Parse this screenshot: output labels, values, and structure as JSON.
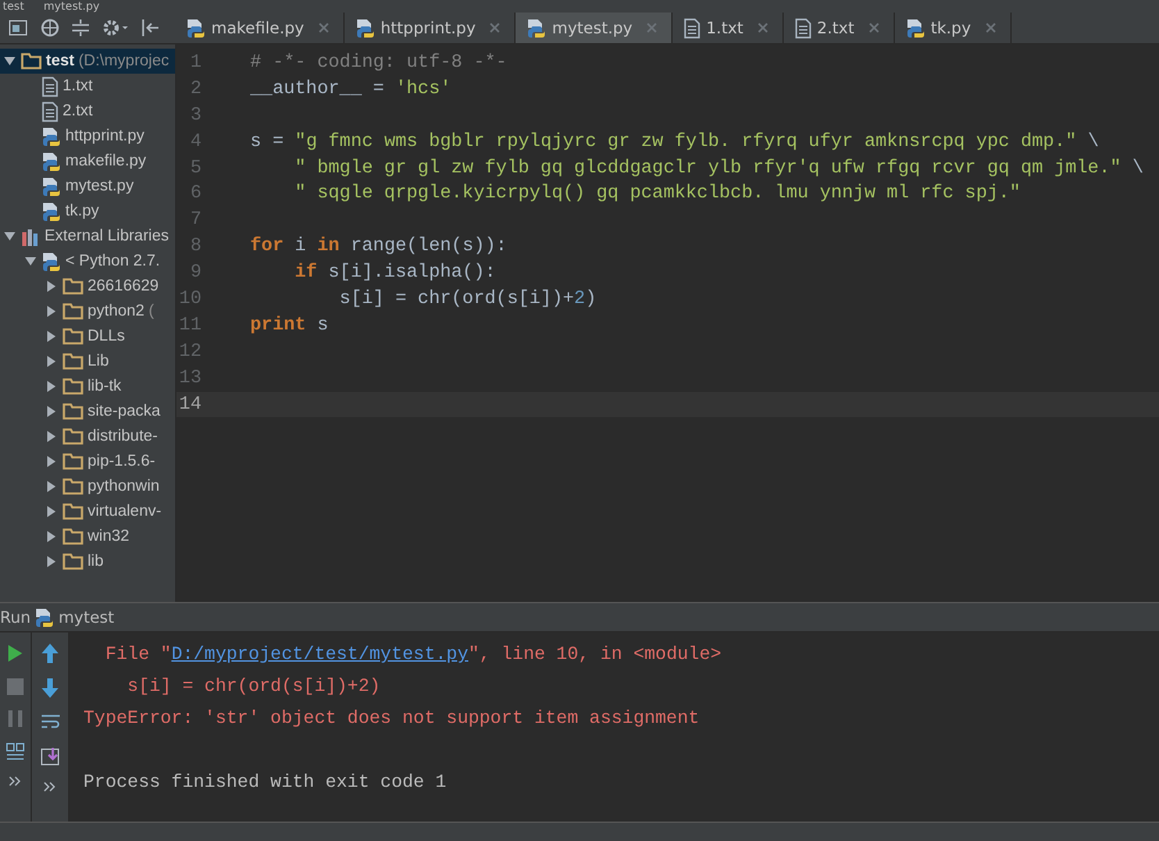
{
  "breadcrumb": [
    "test",
    "mytest.py"
  ],
  "tabs": [
    {
      "label": "makefile.py",
      "kind": "py",
      "selected": false
    },
    {
      "label": "httpprint.py",
      "kind": "py",
      "selected": false
    },
    {
      "label": "mytest.py",
      "kind": "py",
      "selected": true
    },
    {
      "label": "1.txt",
      "kind": "txt",
      "selected": false
    },
    {
      "label": "2.txt",
      "kind": "txt",
      "selected": false
    },
    {
      "label": "tk.py",
      "kind": "py",
      "selected": false
    }
  ],
  "project_tree": [
    {
      "label": "test",
      "hint": "(D:\\myprojec",
      "kind": "folder",
      "expanded": true,
      "selected": true,
      "children": [
        {
          "label": "1.txt",
          "kind": "txt",
          "selected": false
        },
        {
          "label": "2.txt",
          "kind": "txt",
          "selected": false
        },
        {
          "label": "httpprint.py",
          "kind": "py",
          "selected": false
        },
        {
          "label": "makefile.py",
          "kind": "py",
          "selected": false
        },
        {
          "label": "mytest.py",
          "kind": "py",
          "selected": false
        },
        {
          "label": "tk.py",
          "kind": "py",
          "selected": false
        }
      ]
    },
    {
      "label": "External Libraries",
      "kind": "library",
      "expanded": true,
      "selected": false,
      "children": [
        {
          "label": "< Python 2.7.",
          "kind": "python",
          "expanded": true,
          "selected": false,
          "children": [
            {
              "label": "26616629",
              "kind": "folder",
              "expanded": false,
              "selected": false
            },
            {
              "label": "python2",
              "hint": "(",
              "kind": "folder",
              "expanded": false,
              "selected": false
            },
            {
              "label": "DLLs",
              "kind": "folder",
              "expanded": false,
              "selected": false
            },
            {
              "label": "Lib",
              "kind": "folder",
              "expanded": false,
              "selected": false
            },
            {
              "label": "lib-tk",
              "kind": "folder",
              "expanded": false,
              "selected": false
            },
            {
              "label": "site-packa",
              "kind": "folder",
              "expanded": false,
              "selected": false
            },
            {
              "label": "distribute-",
              "kind": "folder",
              "expanded": false,
              "selected": false
            },
            {
              "label": "pip-1.5.6-",
              "kind": "folder",
              "expanded": false,
              "selected": false
            },
            {
              "label": "pythonwin",
              "kind": "folder",
              "expanded": false,
              "selected": false
            },
            {
              "label": "virtualenv-",
              "kind": "folder",
              "expanded": false,
              "selected": false
            },
            {
              "label": "win32",
              "kind": "folder",
              "expanded": false,
              "selected": false
            },
            {
              "label": "lib",
              "kind": "folder",
              "expanded": false,
              "selected": false
            }
          ]
        }
      ]
    }
  ],
  "editor": {
    "lines": [
      {
        "number": "1",
        "current": false,
        "tokens": [
          {
            "text": "# -*- coding: utf-8 -*-",
            "kind": "comment"
          }
        ]
      },
      {
        "number": "2",
        "current": false,
        "tokens": [
          {
            "text": "__author__ = ",
            "kind": "plain"
          },
          {
            "text": "'hcs'",
            "kind": "string"
          }
        ]
      },
      {
        "number": "3",
        "current": false
      },
      {
        "number": "4",
        "current": false,
        "tokens": [
          {
            "text": "s = ",
            "kind": "plain"
          },
          {
            "text": "\"g fmnc wms bgblr rpylqjyrc gr zw fylb. rfyrq ufyr amknsrcpq ypc dmp.\"",
            "kind": "string"
          },
          {
            "text": " \\",
            "kind": "plain"
          }
        ]
      },
      {
        "number": "5",
        "current": false,
        "tokens": [
          {
            "text": "    \" bmgle gr gl zw fylb gq glcddgagclr ylb rfyr'q ufw rfgq rcvr gq qm jmle.\"",
            "kind": "string"
          },
          {
            "text": " \\",
            "kind": "plain"
          }
        ]
      },
      {
        "number": "6",
        "current": false,
        "tokens": [
          {
            "text": "    \" sqgle qrpgle.kyicrpylq() gq pcamkkclbcb. lmu ynnjw ml rfc spj.\"",
            "kind": "string"
          }
        ]
      },
      {
        "number": "7",
        "current": false
      },
      {
        "number": "8",
        "current": false,
        "tokens": [
          {
            "text": "for",
            "kind": "keyword"
          },
          {
            "text": " i ",
            "kind": "plain"
          },
          {
            "text": "in",
            "kind": "keyword"
          },
          {
            "text": " range(len(s)):",
            "kind": "plain"
          }
        ]
      },
      {
        "number": "9",
        "current": false,
        "tokens": [
          {
            "text": "    if",
            "kind": "keyword"
          },
          {
            "text": " s[i].isalpha():",
            "kind": "plain"
          }
        ]
      },
      {
        "number": "10",
        "current": false,
        "tokens": [
          {
            "text": "        s[i] = chr(ord(s[i])+",
            "kind": "plain"
          },
          {
            "text": "2",
            "kind": "number"
          },
          {
            "text": ")",
            "kind": "plain"
          }
        ]
      },
      {
        "number": "11",
        "current": false,
        "tokens": [
          {
            "text": "print",
            "kind": "keyword"
          },
          {
            "text": " s",
            "kind": "plain"
          }
        ]
      },
      {
        "number": "12",
        "current": false
      },
      {
        "number": "13",
        "current": false
      },
      {
        "number": "14",
        "current": true
      }
    ]
  },
  "run_panel": {
    "title": "Run",
    "config": "mytest",
    "output": [
      {
        "kind": "trace",
        "before": "  File \"",
        "link": "D:/myproject/test/mytest.py",
        "after": "\", line 10, in <module>"
      },
      {
        "kind": "error",
        "text": "    s[i] = chr(ord(s[i])+2)"
      },
      {
        "kind": "error",
        "text": "TypeError: 'str' object does not support item assignment"
      },
      {
        "kind": "blank"
      },
      {
        "kind": "normal",
        "text": "Process finished with exit code 1"
      }
    ]
  }
}
